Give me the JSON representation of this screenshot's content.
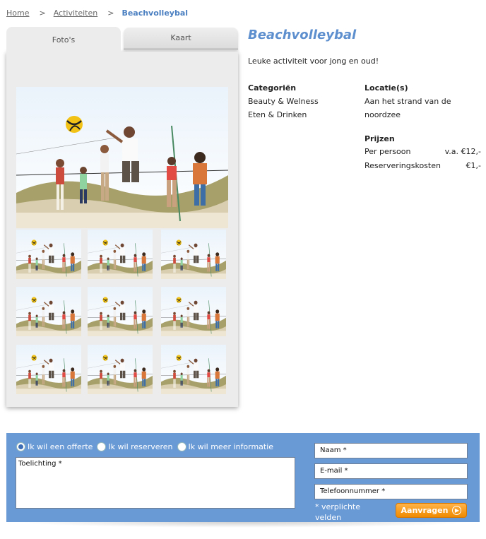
{
  "breadcrumb": {
    "items": [
      "Home",
      "Activiteiten"
    ],
    "separator": ">",
    "current": "Beachvolleybal"
  },
  "gallery": {
    "tabs": [
      "Foto's",
      "Kaart"
    ],
    "active_tab": "Foto's",
    "thumbnail_count": 9
  },
  "activity": {
    "title": "Beachvolleybal",
    "intro": "Leuke activiteit voor jong en oud!",
    "categories_heading": "Categoriën",
    "categories": [
      "Beauty & Welness",
      "Eten & Drinken"
    ],
    "location_heading": "Locatie(s)",
    "location_lines": [
      "Aan het strand van de",
      "noordzee"
    ],
    "prices_heading": "Prijzen",
    "prices": [
      {
        "label": "Per persoon",
        "value": "v.a. €12,-"
      },
      {
        "label": "Reserveringskosten",
        "value": "€1,-"
      }
    ]
  },
  "form": {
    "options": [
      {
        "label": "Ik wil een offerte",
        "selected": true
      },
      {
        "label": "Ik wil reserveren",
        "selected": false
      },
      {
        "label": "Ik wil meer informatie",
        "selected": false
      }
    ],
    "comment_placeholder": "Toelichting *",
    "name_placeholder": "Naam *",
    "email_placeholder": "E-mail *",
    "phone_placeholder": "Telefoonnummer *",
    "required_note": "* verplichte velden",
    "submit_label": "Aanvragen",
    "colors": {
      "panel": "#6a9ad6",
      "button": "#f39a1a",
      "title": "#5d8fce"
    }
  }
}
